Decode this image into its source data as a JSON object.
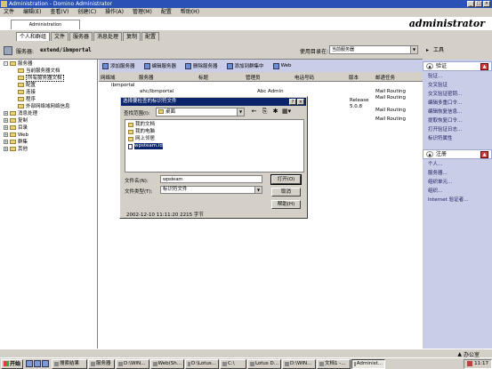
{
  "window": {
    "title": "Administration - Domino Administrator",
    "minimize": "_",
    "maximize": "□",
    "close": "×"
  },
  "menu": [
    "文件",
    "编辑(E)",
    "查看(V)",
    "创建(C)",
    "操作(A)",
    "管理(M)",
    "配置",
    "帮助(H)"
  ],
  "app": {
    "tab": "Administration",
    "user": "administrator"
  },
  "nav": {
    "tabs": [
      "个人和群组",
      "文件",
      "服务器",
      "消息处理",
      "复制",
      "配置"
    ]
  },
  "server": {
    "label": "服务器:",
    "value": "extend/ibmportal",
    "use_dir_label": "使用目录在:",
    "use_dir_value": "当前服务器"
  },
  "tree": [
    {
      "label": "服务器",
      "pm": "-"
    },
    {
      "label": "当前服务器文档"
    },
    {
      "label": "所有服务器文档",
      "selected": true
    },
    {
      "label": "配置"
    },
    {
      "label": "连接"
    },
    {
      "label": "程序"
    },
    {
      "label": "外部网络域网络信息"
    },
    {
      "label": "消息处理",
      "pm": "+"
    },
    {
      "label": "复制",
      "pm": "+"
    },
    {
      "label": "目录",
      "pm": "+"
    },
    {
      "label": "Web",
      "pm": "+"
    },
    {
      "label": "群集",
      "pm": "+"
    },
    {
      "label": "其他",
      "pm": "+"
    }
  ],
  "toolbar": [
    "添加服务器",
    "编辑服务器",
    "删除服务器",
    "添加到群集中",
    "Web"
  ],
  "columns": [
    "网络域",
    "服务器",
    "标题",
    "管理员",
    "电话号码",
    "版本",
    "邮递任务"
  ],
  "rows": {
    "domain": "ibmportal",
    "server": "ahc/ibmportal",
    "admin": "Abc Admin",
    "mail1": "Mail Routing",
    "mail2": "Mail Routing",
    "release": "Release",
    "version": "5.0.8",
    "mail3": "Mail Routing",
    "mail4": "Mail Routing"
  },
  "dialog": {
    "title": "选择要检查的标识符文件",
    "help": "?",
    "close": "×",
    "lookin_label": "查找范围(I):",
    "lookin_value": "桌面",
    "nav_icons": [
      "←",
      "⎘",
      "✱",
      "▦▾"
    ],
    "files": [
      "我的文档",
      "我的电脑",
      "网上邻居",
      "wpsteam.id"
    ],
    "filename_label": "文件名(N):",
    "filename_value": "wpsteam",
    "filetype_label": "文件类型(T):",
    "filetype_value": "标识符文件",
    "open": "打开(O)",
    "cancel": "取消",
    "help_btn": "帮助(H)",
    "status": "2002-12-10 11:11:20 2215 字节"
  },
  "tools": {
    "header": "工具",
    "sec1": {
      "title": "验证",
      "items": [
        "验证...",
        "交叉验证",
        "交叉验证密钥...",
        "编辑多重口令...",
        "编辑恢复信息...",
        "提取恢复口令...",
        "打开验证日志...",
        "标识符属性"
      ]
    },
    "sec2": {
      "title": "注册",
      "items": [
        "个人...",
        "服务器...",
        "组织单元...",
        "组织...",
        "Internet 验证者..."
      ]
    }
  },
  "status": {
    "zone": "办公室"
  },
  "taskbar": {
    "start": "开始",
    "items": [
      "搜索结果",
      "服务器",
      "D:\\WIN...",
      "Web(Sh...",
      "D:\\Lotus...",
      "C:\\",
      "Lotus D...",
      "D:\\WIN...",
      "文档1 -...",
      "Administ..."
    ],
    "time": "11:17"
  }
}
